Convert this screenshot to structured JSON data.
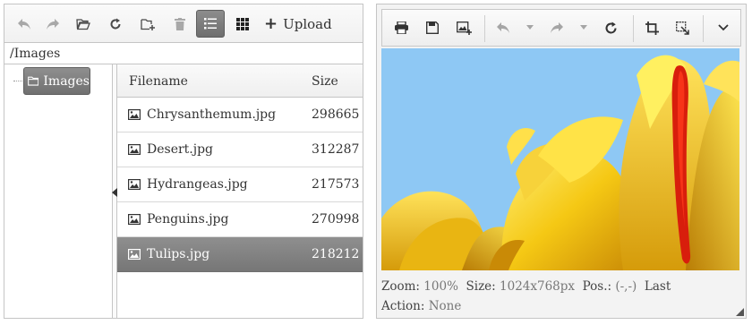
{
  "explorer": {
    "toolbar": {
      "upload_label": "Upload",
      "buttons": [
        "back-icon",
        "forward-icon",
        "open-folder-icon",
        "refresh-icon",
        "new-folder-icon",
        "delete-icon",
        "list-view-icon",
        "grid-view-icon"
      ]
    },
    "path": "/Images",
    "tree": {
      "root_label": "Images"
    },
    "grid": {
      "columns": {
        "name": "Filename",
        "size": "Size"
      },
      "rows": [
        {
          "name": "Chrysanthemum.jpg",
          "size": "298665"
        },
        {
          "name": "Desert.jpg",
          "size": "312287"
        },
        {
          "name": "Hydrangeas.jpg",
          "size": "217573"
        },
        {
          "name": "Penguins.jpg",
          "size": "270998"
        },
        {
          "name": "Tulips.jpg",
          "size": "218212",
          "selected": true
        }
      ]
    }
  },
  "editor": {
    "toolbar": {
      "buttons": [
        "print-icon",
        "save-icon",
        "insert-image-icon",
        "undo-icon",
        "redo-icon",
        "reset-icon",
        "crop-icon",
        "resize-icon",
        "chevron-down-icon"
      ]
    },
    "status": {
      "zoom_label": "Zoom:",
      "zoom": "100%",
      "size_label": "Size:",
      "size": "1024x768px",
      "pos_label": "Pos.:",
      "pos": "(-,-)",
      "last_label": "Last",
      "action_label": "Action:",
      "action": "None"
    }
  },
  "colors": {
    "accent": "#7a7a7a",
    "sky": "#8ec8f4",
    "tulip": "#f2c61a",
    "stripe": "#d81e0c"
  }
}
